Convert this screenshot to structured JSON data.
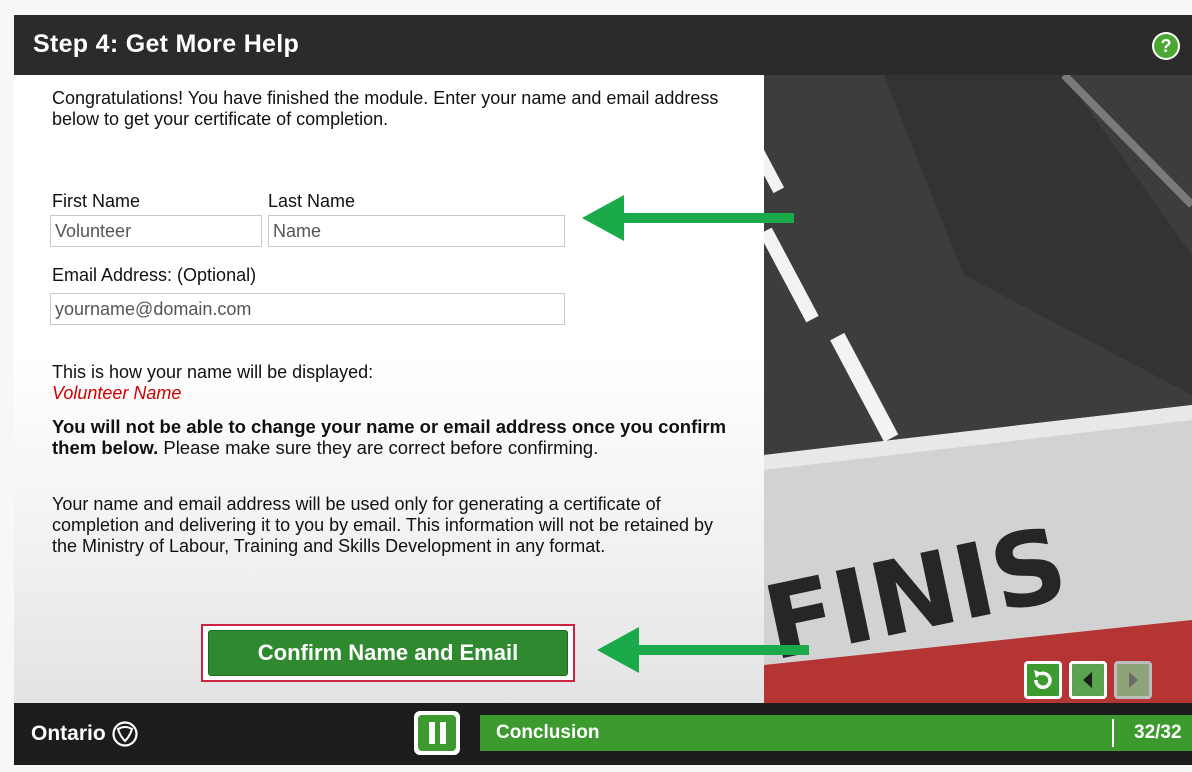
{
  "header": {
    "title": "Step 4: Get More Help",
    "help_label": "?"
  },
  "intro": "Congratulations! You have finished the module. Enter your name and email address below to get your certificate of completion.",
  "form": {
    "first_name_label": "First Name",
    "last_name_label": "Last Name",
    "first_name_value": "Volunteer",
    "last_name_value": "Name",
    "email_label": "Email Address: (Optional)",
    "email_placeholder": "yourname@domain.com"
  },
  "display": {
    "intro": "This is how your name will be displayed:",
    "name": "Volunteer Name"
  },
  "warning": {
    "bold": "You will not be able to change your name or email address once you confirm them below.",
    "normal": " Please make sure they are correct before confirming."
  },
  "privacy": "Your name and email address will be used only for generating a certificate of completion and delivering it to you by email. This information will not be retained by the Ministry of Labour, Training and Skills Development in any format.",
  "confirm_label": "Confirm Name and Email",
  "photo_text": "FINIS",
  "footer": {
    "brand": "Ontario",
    "chapter": "Conclusion",
    "page": "32/32"
  },
  "colors": {
    "accent_green": "#3c9a2e",
    "arrow_green": "#1aaa4a",
    "highlight_red": "#cc2244",
    "name_red": "#d10000"
  },
  "icons": [
    "help-icon",
    "replay-icon",
    "back-icon",
    "forward-icon",
    "pause-icon",
    "ontario-trillium-logo"
  ]
}
